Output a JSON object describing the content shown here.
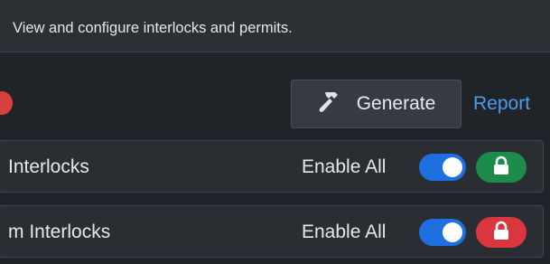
{
  "header": {
    "description": "View and configure interlocks and permits."
  },
  "toolbar": {
    "generate_label": "Generate",
    "report_label": "Report",
    "generate_icon": "hammer-icon",
    "status_color": "#d8403e"
  },
  "groups": [
    {
      "title": "Interlocks",
      "enable_all_label": "Enable All",
      "enabled": true,
      "lock_state": "locked",
      "lock_color": "#1d8b4a"
    },
    {
      "title": "m Interlocks",
      "enable_all_label": "Enable All",
      "enabled": true,
      "lock_state": "locked",
      "lock_color": "#d9363e"
    }
  ],
  "colors": {
    "accent_blue": "#1e6fe0",
    "link_blue": "#4f9cf0",
    "background": "#202327"
  }
}
